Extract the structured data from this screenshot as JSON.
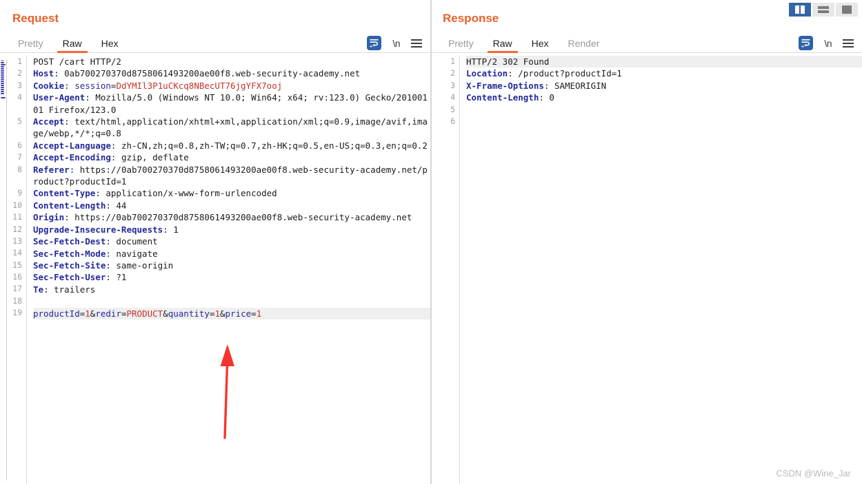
{
  "layout_toggles": [
    {
      "name": "two-pane-vertical",
      "label": "Two pane vertical",
      "active": true
    },
    {
      "name": "two-pane-horizontal",
      "label": "Two pane horizontal",
      "active": false
    },
    {
      "name": "single-pane",
      "label": "Single pane",
      "active": false
    }
  ],
  "request": {
    "title": "Request",
    "tabs": [
      {
        "label": "Pretty",
        "active": false,
        "muted": true
      },
      {
        "label": "Raw",
        "active": true,
        "muted": false
      },
      {
        "label": "Hex",
        "active": false,
        "muted": false
      }
    ],
    "tools": {
      "wrap_label": "word-wrap",
      "newline_label": "\\n",
      "menu_label": "menu"
    },
    "line_count": 19,
    "lines": [
      {
        "n": 1,
        "highlight": false,
        "parts": [
          {
            "t": "plain",
            "s": "POST /cart HTTP/2"
          }
        ]
      },
      {
        "n": 2,
        "highlight": false,
        "parts": [
          {
            "t": "hdr",
            "s": "Host"
          },
          {
            "t": "plain",
            "s": ": 0ab700270370d8758061493200ae00f8.web-security-academy.net"
          }
        ]
      },
      {
        "n": 3,
        "highlight": false,
        "parts": [
          {
            "t": "hdr",
            "s": "Cookie"
          },
          {
            "t": "plain",
            "s": ": "
          },
          {
            "t": "key",
            "s": "session"
          },
          {
            "t": "plain",
            "s": "="
          },
          {
            "t": "red",
            "s": "DdYMIl3P1uCKcq8NBecUT76jgYFX7ooj"
          }
        ]
      },
      {
        "n": 4,
        "highlight": false,
        "parts": [
          {
            "t": "hdr",
            "s": "User-Agent"
          },
          {
            "t": "plain",
            "s": ": Mozilla/5.0 (Windows NT 10.0; Win64; x64; rv:123.0) Gecko/20100101 Firefox/123.0"
          }
        ]
      },
      {
        "n": 5,
        "highlight": false,
        "parts": [
          {
            "t": "hdr",
            "s": "Accept"
          },
          {
            "t": "plain",
            "s": ": text/html,application/xhtml+xml,application/xml;q=0.9,image/avif,image/webp,*/*;q=0.8"
          }
        ]
      },
      {
        "n": 6,
        "highlight": false,
        "parts": [
          {
            "t": "hdr",
            "s": "Accept-Language"
          },
          {
            "t": "plain",
            "s": ": zh-CN,zh;q=0.8,zh-TW;q=0.7,zh-HK;q=0.5,en-US;q=0.3,en;q=0.2"
          }
        ]
      },
      {
        "n": 7,
        "highlight": false,
        "parts": [
          {
            "t": "hdr",
            "s": "Accept-Encoding"
          },
          {
            "t": "plain",
            "s": ": gzip, deflate"
          }
        ]
      },
      {
        "n": 8,
        "highlight": false,
        "parts": [
          {
            "t": "hdr",
            "s": "Referer"
          },
          {
            "t": "plain",
            "s": ": https://0ab700270370d8758061493200ae00f8.web-security-academy.net/product?productId=1"
          }
        ]
      },
      {
        "n": 9,
        "highlight": false,
        "parts": [
          {
            "t": "hdr",
            "s": "Content-Type"
          },
          {
            "t": "plain",
            "s": ": application/x-www-form-urlencoded"
          }
        ]
      },
      {
        "n": 10,
        "highlight": false,
        "parts": [
          {
            "t": "hdr",
            "s": "Content-Length"
          },
          {
            "t": "plain",
            "s": ": 44"
          }
        ]
      },
      {
        "n": 11,
        "highlight": false,
        "parts": [
          {
            "t": "hdr",
            "s": "Origin"
          },
          {
            "t": "plain",
            "s": ": https://0ab700270370d8758061493200ae00f8.web-security-academy.net"
          }
        ]
      },
      {
        "n": 12,
        "highlight": false,
        "parts": [
          {
            "t": "hdr",
            "s": "Upgrade-Insecure-Requests"
          },
          {
            "t": "plain",
            "s": ": 1"
          }
        ]
      },
      {
        "n": 13,
        "highlight": false,
        "parts": [
          {
            "t": "hdr",
            "s": "Sec-Fetch-Dest"
          },
          {
            "t": "plain",
            "s": ": document"
          }
        ]
      },
      {
        "n": 14,
        "highlight": false,
        "parts": [
          {
            "t": "hdr",
            "s": "Sec-Fetch-Mode"
          },
          {
            "t": "plain",
            "s": ": navigate"
          }
        ]
      },
      {
        "n": 15,
        "highlight": false,
        "parts": [
          {
            "t": "hdr",
            "s": "Sec-Fetch-Site"
          },
          {
            "t": "plain",
            "s": ": same-origin"
          }
        ]
      },
      {
        "n": 16,
        "highlight": false,
        "parts": [
          {
            "t": "hdr",
            "s": "Sec-Fetch-User"
          },
          {
            "t": "plain",
            "s": ": ?1"
          }
        ]
      },
      {
        "n": 17,
        "highlight": false,
        "parts": [
          {
            "t": "hdr",
            "s": "Te"
          },
          {
            "t": "plain",
            "s": ": trailers"
          }
        ]
      },
      {
        "n": 18,
        "highlight": false,
        "parts": [
          {
            "t": "plain",
            "s": ""
          }
        ]
      },
      {
        "n": 19,
        "highlight": true,
        "parts": [
          {
            "t": "key",
            "s": "productId"
          },
          {
            "t": "plain",
            "s": "="
          },
          {
            "t": "red",
            "s": "1"
          },
          {
            "t": "plain",
            "s": "&"
          },
          {
            "t": "key",
            "s": "redir"
          },
          {
            "t": "plain",
            "s": "="
          },
          {
            "t": "red",
            "s": "PRODUCT"
          },
          {
            "t": "plain",
            "s": "&"
          },
          {
            "t": "key",
            "s": "quantity"
          },
          {
            "t": "plain",
            "s": "="
          },
          {
            "t": "red",
            "s": "1"
          },
          {
            "t": "plain",
            "s": "&"
          },
          {
            "t": "key",
            "s": "price"
          },
          {
            "t": "plain",
            "s": "="
          },
          {
            "t": "red",
            "s": "1"
          }
        ]
      }
    ]
  },
  "response": {
    "title": "Response",
    "tabs": [
      {
        "label": "Pretty",
        "active": false,
        "muted": true
      },
      {
        "label": "Raw",
        "active": true,
        "muted": false
      },
      {
        "label": "Hex",
        "active": false,
        "muted": false
      },
      {
        "label": "Render",
        "active": false,
        "muted": true
      }
    ],
    "tools": {
      "wrap_label": "word-wrap",
      "newline_label": "\\n",
      "menu_label": "menu"
    },
    "line_count": 6,
    "lines": [
      {
        "n": 1,
        "highlight": true,
        "parts": [
          {
            "t": "plain",
            "s": "HTTP/2 302 Found"
          }
        ]
      },
      {
        "n": 2,
        "highlight": false,
        "parts": [
          {
            "t": "hdr",
            "s": "Location"
          },
          {
            "t": "plain",
            "s": ": /product?productId=1"
          }
        ]
      },
      {
        "n": 3,
        "highlight": false,
        "parts": [
          {
            "t": "hdr",
            "s": "X-Frame-Options"
          },
          {
            "t": "plain",
            "s": ": SAMEORIGIN"
          }
        ]
      },
      {
        "n": 4,
        "highlight": false,
        "parts": [
          {
            "t": "hdr",
            "s": "Content-Length"
          },
          {
            "t": "plain",
            "s": ": 0"
          }
        ]
      },
      {
        "n": 5,
        "highlight": false,
        "parts": [
          {
            "t": "plain",
            "s": ""
          }
        ]
      },
      {
        "n": 6,
        "highlight": false,
        "parts": [
          {
            "t": "plain",
            "s": ""
          }
        ]
      }
    ]
  },
  "annotation": {
    "arrow_color": "#f5352c",
    "arrow_label": "points-to-request-body"
  },
  "watermark": "CSDN @Wine_Jar",
  "colors": {
    "accent_orange": "#e8622c",
    "tab_underline": "#f06a35",
    "header_blue": "#242a9c",
    "value_red": "#c8322b",
    "toggle_active": "#3465a4",
    "line_highlight": "#efefef"
  }
}
